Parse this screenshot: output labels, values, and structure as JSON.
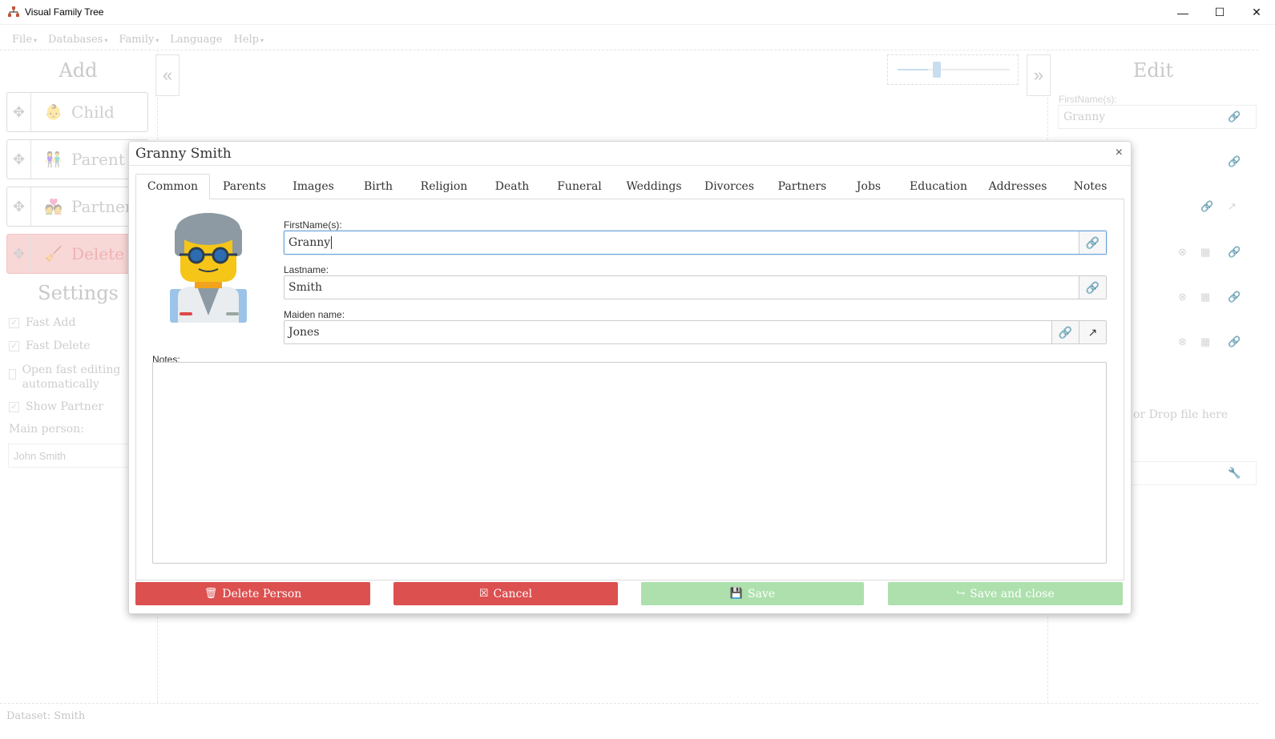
{
  "window": {
    "title": "Visual Family Tree",
    "minimize": "—",
    "maximize": "☐",
    "close": "✕"
  },
  "menu": {
    "items": [
      {
        "label": "File",
        "caret": "▾"
      },
      {
        "label": "Databases",
        "caret": "▾"
      },
      {
        "label": "Family",
        "caret": "▾"
      },
      {
        "label": "Language",
        "caret": ""
      },
      {
        "label": "Help",
        "caret": "▾"
      }
    ]
  },
  "left_panel": {
    "add_heading": "Add",
    "collapse_icon": "«",
    "buttons": [
      {
        "label": "Child",
        "icon": "child-icon"
      },
      {
        "label": "Parent",
        "icon": "parent-icon"
      },
      {
        "label": "Partner",
        "icon": "partner-icon"
      },
      {
        "label": "Delete",
        "icon": "delete-icon"
      }
    ],
    "settings_heading": "Settings",
    "settings": [
      {
        "label": "Fast Add",
        "checked": true
      },
      {
        "label": "Fast Delete",
        "checked": true
      },
      {
        "label": "Open fast editing automatically",
        "checked": false
      },
      {
        "label": "Show Partner",
        "checked": true
      }
    ],
    "main_person_label": "Main person:",
    "main_person_value": "John Smith"
  },
  "right_panel": {
    "heading": "Edit",
    "expand_icon": "»",
    "firstname_label": "FirstName(s):",
    "firstname_value": "Granny",
    "drop_text": "or Drop file here",
    "zoom_level": 0.3
  },
  "dialog": {
    "title": "Granny Smith",
    "close": "×",
    "tabs": [
      "Common",
      "Parents",
      "Images",
      "Birth",
      "Religion",
      "Death",
      "Funeral",
      "Weddings",
      "Divorces",
      "Partners",
      "Jobs",
      "Education",
      "Addresses",
      "Notes"
    ],
    "active_tab": "Common",
    "firstname_label": "FirstName(s):",
    "firstname_value": "Granny",
    "lastname_label": "Lastname:",
    "lastname_value": "Smith",
    "maiden_label": "Maiden name:",
    "maiden_value": "Jones",
    "notes_label": "Notes:",
    "notes_value": "",
    "buttons": {
      "delete": "Delete Person",
      "cancel": "Cancel",
      "save": "Save",
      "save_close": "Save and close"
    },
    "colors": {
      "danger": "#dc5050",
      "success_disabled": "#ade0ad"
    }
  },
  "status": {
    "dataset": "Dataset: Smith"
  }
}
